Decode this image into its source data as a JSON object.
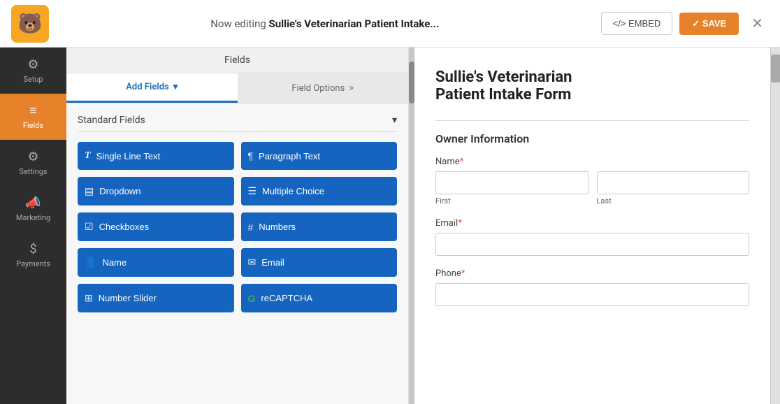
{
  "topbar": {
    "editing_prefix": "Now editing ",
    "form_name": "Sullie's Veterinarian Patient Intake...",
    "embed_label": "</> EMBED",
    "save_label": "✓ SAVE",
    "close_label": "✕"
  },
  "sidebar": {
    "items": [
      {
        "id": "setup",
        "label": "Setup",
        "icon": "⚙"
      },
      {
        "id": "fields",
        "label": "Fields",
        "icon": "≡",
        "active": true
      },
      {
        "id": "settings",
        "label": "Settings",
        "icon": "⚙"
      },
      {
        "id": "marketing",
        "label": "Marketing",
        "icon": "📣"
      },
      {
        "id": "payments",
        "label": "Payments",
        "icon": "$"
      }
    ]
  },
  "fields_panel": {
    "header": "Fields",
    "tabs": [
      {
        "id": "add-fields",
        "label": "Add Fields",
        "active": true,
        "arrow": "▾"
      },
      {
        "id": "field-options",
        "label": "Field Options",
        "active": false,
        "arrow": ">"
      }
    ],
    "section_label": "Standard Fields",
    "field_buttons": [
      {
        "id": "single-line-text",
        "icon": "T",
        "label": "Single Line Text"
      },
      {
        "id": "paragraph-text",
        "icon": "¶",
        "label": "Paragraph Text"
      },
      {
        "id": "dropdown",
        "icon": "▤",
        "label": "Dropdown"
      },
      {
        "id": "multiple-choice",
        "icon": "☰",
        "label": "Multiple Choice"
      },
      {
        "id": "checkboxes",
        "icon": "☑",
        "label": "Checkboxes"
      },
      {
        "id": "numbers",
        "icon": "#",
        "label": "Numbers"
      },
      {
        "id": "name",
        "icon": "👤",
        "label": "Name"
      },
      {
        "id": "email",
        "icon": "✉",
        "label": "Email"
      },
      {
        "id": "number-slider",
        "icon": "⊞",
        "label": "Number Slider"
      },
      {
        "id": "recaptcha",
        "icon": "G",
        "label": "reCAPTCHA"
      }
    ]
  },
  "form_preview": {
    "title_line1": "Sullie's Veterinarian",
    "title_line2": "Patient Intake Form",
    "section_title": "Owner Information",
    "fields": [
      {
        "id": "name",
        "label": "Name",
        "required": true,
        "type": "name",
        "subfields": [
          "First",
          "Last"
        ]
      },
      {
        "id": "email",
        "label": "Email",
        "required": true,
        "type": "text"
      },
      {
        "id": "phone",
        "label": "Phone",
        "required": true,
        "type": "text"
      }
    ]
  }
}
